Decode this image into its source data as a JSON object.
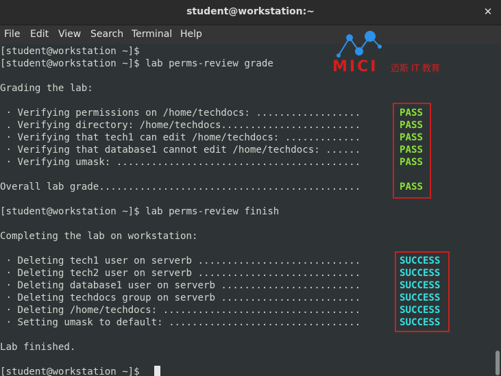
{
  "window": {
    "title": "student@workstation:~",
    "close_glyph": "✕"
  },
  "menu": {
    "items": [
      "File",
      "Edit",
      "View",
      "Search",
      "Terminal",
      "Help"
    ]
  },
  "logo": {
    "brand": "MICI",
    "subtitle": "迈斯 IT 教育"
  },
  "terminal": {
    "lines": [
      "[student@workstation ~]$",
      "[student@workstation ~]$ lab perms-review grade",
      "",
      "Grading the lab:",
      "",
      " · Verifying permissions on /home/techdocs: ..................",
      " . Verifying directory: /home/techdocs........................",
      " · Verifying that tech1 can edit /home/techdocs: .............",
      " · Verifying that database1 cannot edit /home/techdocs: ......",
      " · Verifying umask: ..........................................",
      "",
      "Overall lab grade.............................................",
      "",
      "[student@workstation ~]$ lab perms-review finish",
      "",
      "Completing the lab on workstation:",
      "",
      " · Deleting tech1 user on serverb ............................",
      " · Deleting tech2 user on serverb ............................",
      " · Deleting database1 user on serverb ........................",
      " · Deleting techdocs group on serverb ........................",
      " · Deleting /home/techdocs: ..................................",
      " · Setting umask to default: .................................",
      "",
      "Lab finished.",
      "",
      "[student@workstation ~]$ "
    ],
    "grade_status": [
      "PASS",
      "PASS",
      "PASS",
      "PASS",
      "PASS"
    ],
    "overall_status": "PASS",
    "finish_status": [
      "SUCCESS",
      "SUCCESS",
      "SUCCESS",
      "SUCCESS",
      "SUCCESS",
      "SUCCESS"
    ]
  },
  "colors": {
    "pass": "#8ae234",
    "success": "#34e2e2",
    "highlight_box": "#cc1f1f",
    "background": "#2e3436"
  }
}
